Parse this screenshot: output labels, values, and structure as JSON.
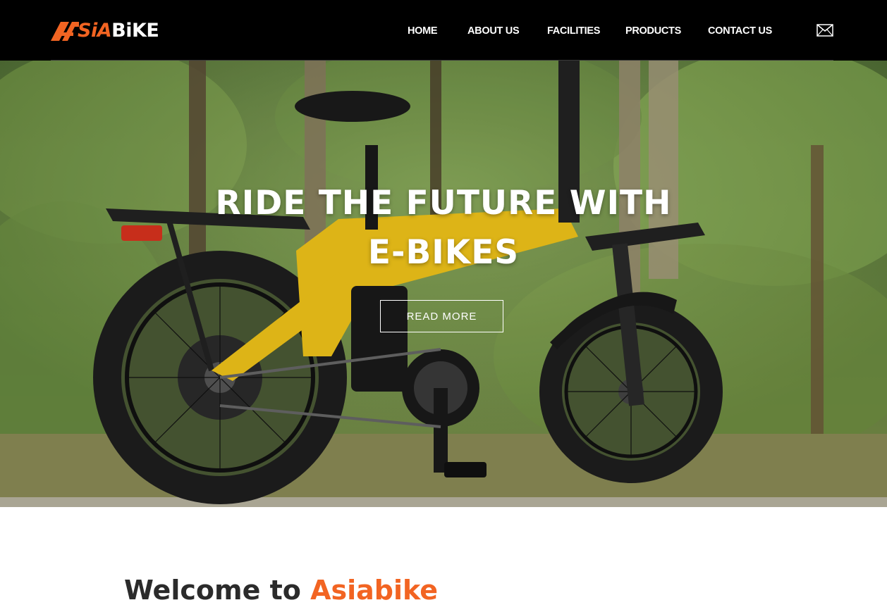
{
  "brand": {
    "logo_prefix": "A",
    "logo_sia": "SiA",
    "logo_bike": "BiKE",
    "accent_color": "#f26422"
  },
  "nav": {
    "items": [
      {
        "label": "HOME"
      },
      {
        "label": "ABOUT US"
      },
      {
        "label": "FACILITIES"
      },
      {
        "label": "PRODUCTS"
      },
      {
        "label": "CONTACT US"
      }
    ],
    "mail_icon": "mail-icon"
  },
  "hero": {
    "title_line1": "RIDE THE FUTURE WITH",
    "title_line2": "E-BIKES",
    "cta_label": "READ MORE"
  },
  "welcome": {
    "prefix": "Welcome to",
    "brand": "Asiabike"
  }
}
